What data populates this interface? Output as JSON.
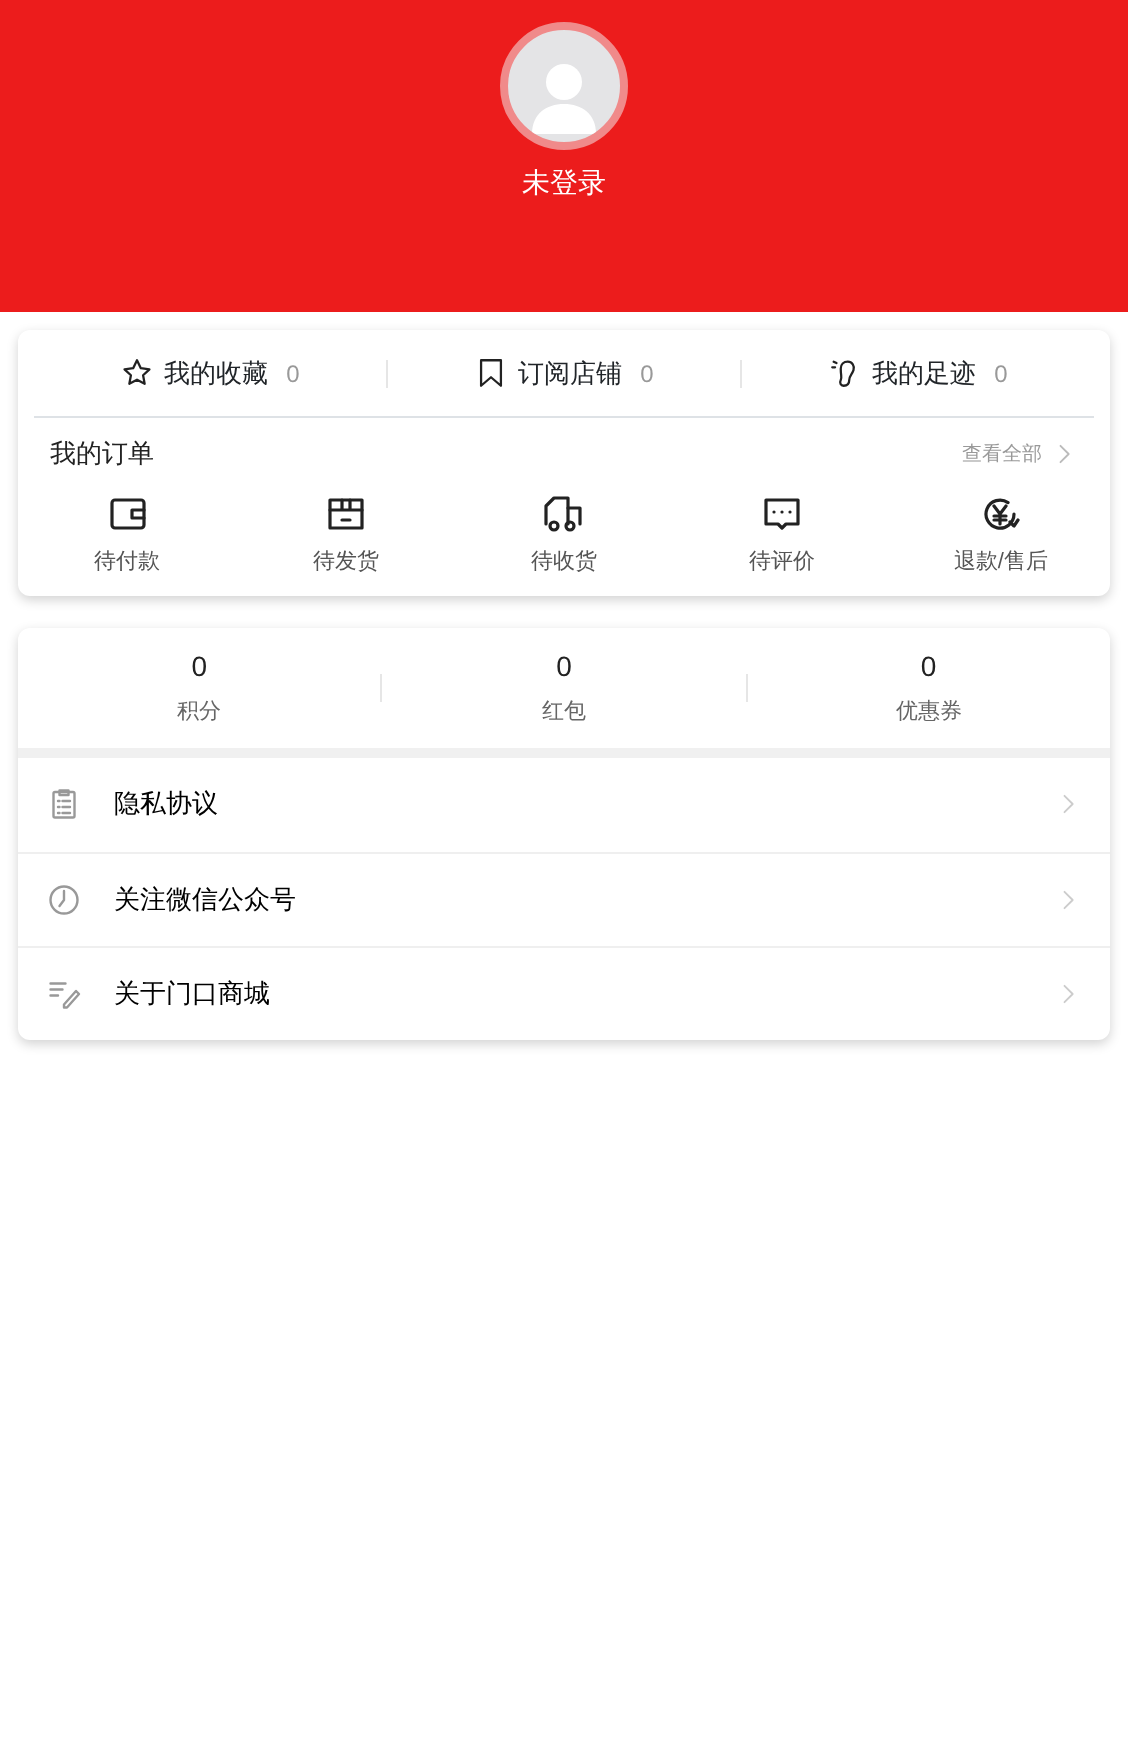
{
  "profile": {
    "status": "未登录"
  },
  "shortcuts": [
    {
      "label": "我的收藏",
      "count": "0"
    },
    {
      "label": "订阅店铺",
      "count": "0"
    },
    {
      "label": "我的足迹",
      "count": "0"
    }
  ],
  "orders": {
    "title": "我的订单",
    "view_all": "查看全部",
    "items": [
      {
        "label": "待付款"
      },
      {
        "label": "待发货"
      },
      {
        "label": "待收货"
      },
      {
        "label": "待评价"
      },
      {
        "label": "退款/售后"
      }
    ]
  },
  "assets": [
    {
      "value": "0",
      "label": "积分"
    },
    {
      "value": "0",
      "label": "红包"
    },
    {
      "value": "0",
      "label": "优惠券"
    }
  ],
  "menu": [
    {
      "label": "隐私协议"
    },
    {
      "label": "关注微信公众号"
    },
    {
      "label": "关于门口商城"
    }
  ]
}
